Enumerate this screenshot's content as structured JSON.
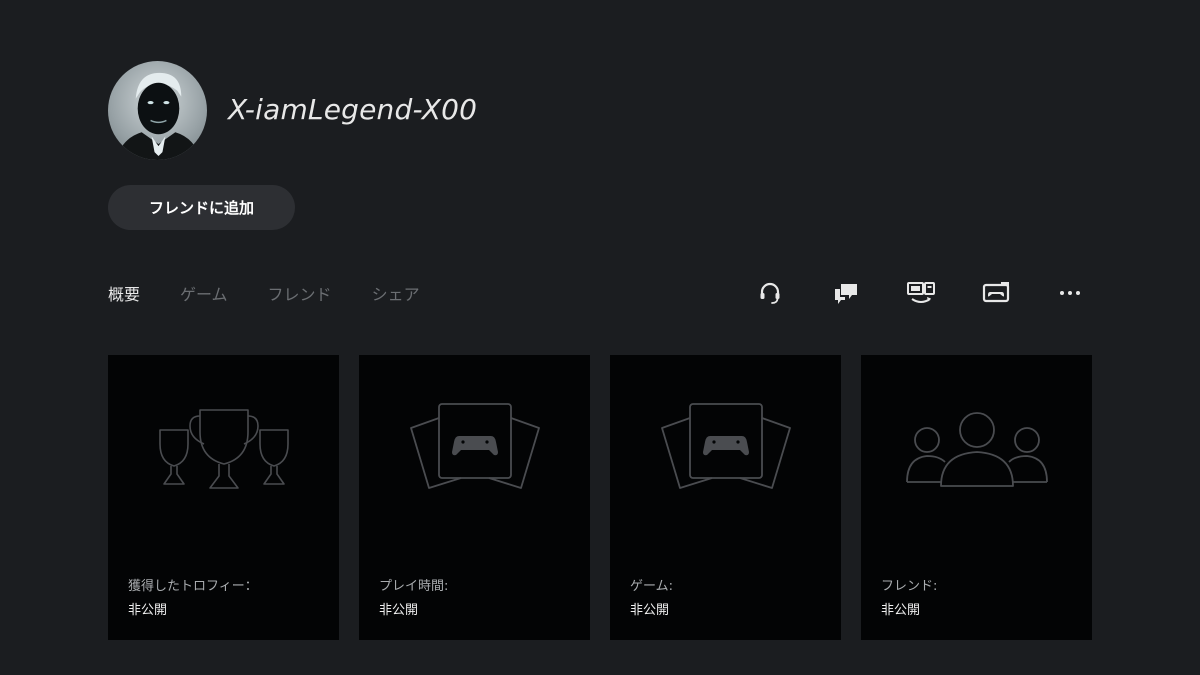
{
  "profile": {
    "username": "X-iamLegend-X00",
    "add_friend_label": "フレンドに追加"
  },
  "tabs": [
    {
      "label": "概要",
      "active": true
    },
    {
      "label": "ゲーム",
      "active": false
    },
    {
      "label": "フレンド",
      "active": false
    },
    {
      "label": "シェア",
      "active": false
    }
  ],
  "actions": [
    {
      "icon": "headset-icon"
    },
    {
      "icon": "chat-icon"
    },
    {
      "icon": "remote-play-icon"
    },
    {
      "icon": "share-screen-icon"
    },
    {
      "icon": "more-icon"
    }
  ],
  "cards": [
    {
      "icon": "trophies-icon",
      "label": "獲得したトロフィー：",
      "value": "非公開"
    },
    {
      "icon": "game-cards-icon",
      "label": "プレイ時間:",
      "value": "非公開"
    },
    {
      "icon": "game-cards-icon",
      "label": "ゲーム:",
      "value": "非公開"
    },
    {
      "icon": "friends-icon",
      "label": "フレンド:",
      "value": "非公開"
    }
  ],
  "colors": {
    "background": "#1b1d20",
    "card_background": "#030405",
    "button_background": "#2d2f33",
    "inactive_tab": "#6b6e72",
    "icon_stroke": "#4a4c50"
  }
}
